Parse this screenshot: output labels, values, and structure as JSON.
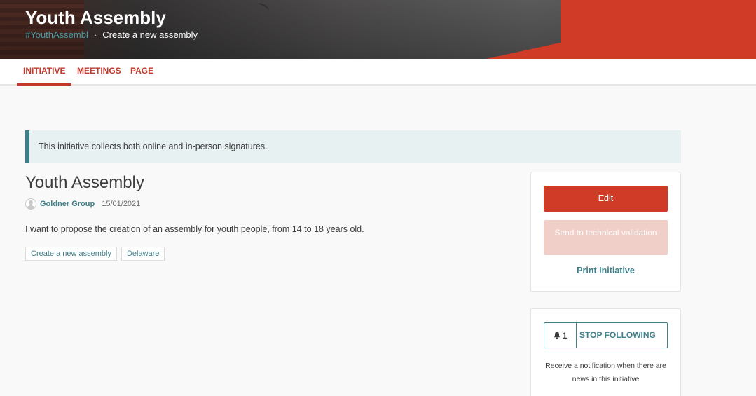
{
  "header": {
    "title": "Youth Assembly",
    "hashtag": "#YouthAssembl",
    "separator": "·",
    "subtitle": "Create a new assembly"
  },
  "tabs": [
    {
      "label": "INITIATIVE",
      "active": true
    },
    {
      "label": "MEETINGS",
      "active": false
    },
    {
      "label": "PAGE",
      "active": false
    }
  ],
  "callout": {
    "text": "This initiative collects both online and in-person signatures."
  },
  "initiative": {
    "title": "Youth Assembly",
    "author": "Goldner Group",
    "date": "15/01/2021",
    "description": "I want to propose the creation of an assembly for youth people, from 14 to 18 years old.",
    "tags": [
      "Create a new assembly",
      "Delaware"
    ]
  },
  "actions": {
    "edit_label": "Edit",
    "send_label": "Send to technical validation",
    "print_label": "Print Initiative"
  },
  "follow": {
    "count": "1",
    "label": "STOP FOLLOWING",
    "note": "Receive a notification when there are news in this initiative"
  },
  "colors": {
    "accent": "#cf3b26",
    "secondary": "#3e7f89",
    "callout_bg": "#e8f1f2"
  },
  "icons": {
    "bell": "bell-icon",
    "avatar": "default-avatar-icon"
  }
}
